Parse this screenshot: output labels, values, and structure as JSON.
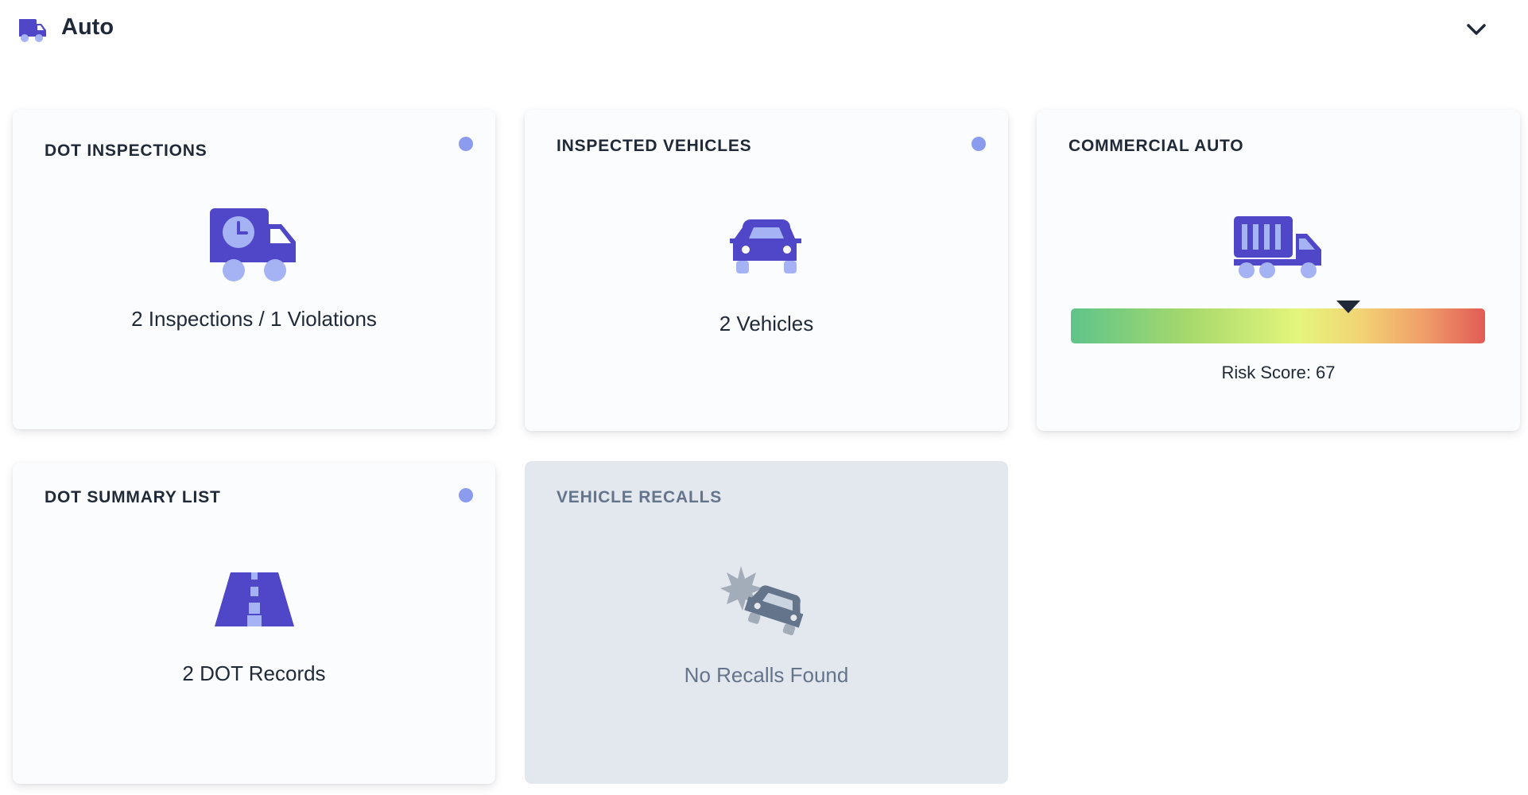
{
  "header": {
    "title": "Auto",
    "icon": "truck-icon",
    "toggle_icon": "chevron-down-icon"
  },
  "colors": {
    "accent": "#5046c8",
    "accent_light": "#a5b2f3",
    "status_dot": "#8b9cef",
    "disabled_card": "#e3e7ee",
    "disabled_text": "#64748b"
  },
  "cards": {
    "dot_inspections": {
      "title": "DOT INSPECTIONS",
      "value": "2 Inspections / 1 Violations",
      "icon": "truck-clock-icon",
      "has_indicator": true
    },
    "inspected_vehicles": {
      "title": "INSPECTED VEHICLES",
      "value": "2 Vehicles",
      "icon": "car-icon",
      "has_indicator": true
    },
    "commercial_auto": {
      "title": "COMMERCIAL AUTO",
      "icon": "truck-container-icon",
      "risk_label": "Risk Score: 67",
      "risk_score": 67
    },
    "dot_summary_list": {
      "title": "DOT SUMMARY LIST",
      "value": "2 DOT Records",
      "icon": "road-icon",
      "has_indicator": true
    },
    "vehicle_recalls": {
      "title": "VEHICLE RECALLS",
      "value": "No Recalls Found",
      "icon": "car-burst-icon",
      "disabled": true
    }
  }
}
